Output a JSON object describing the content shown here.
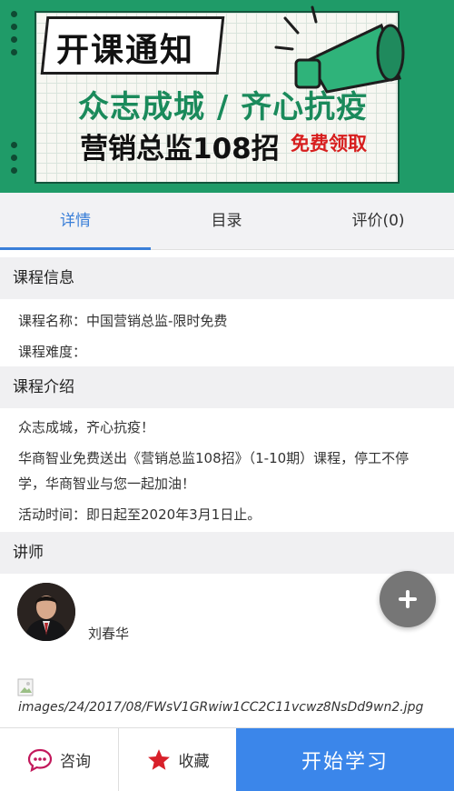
{
  "banner": {
    "title_tag": "开课通知",
    "line1": "众志成城 / 齐心抗疫",
    "line2": "营销总监108招",
    "free": "免费领取"
  },
  "tabs": [
    {
      "label": "详情",
      "active": true
    },
    {
      "label": "目录",
      "active": false
    },
    {
      "label": "评价(0)",
      "active": false
    }
  ],
  "course_info": {
    "heading": "课程信息",
    "name_line": "课程名称：中国营销总监-限时免费",
    "difficulty_line": "课程难度："
  },
  "course_intro": {
    "heading": "课程介绍",
    "p1": "众志成城，齐心抗疫！",
    "p2": "华商智业免费送出《营销总监108招》（1-10期）课程，停工不停学，华商智业与您一起加油！",
    "p3": "活动时间：即日起至2020年3月1日止。"
  },
  "lecturer": {
    "heading": "讲师",
    "name": "刘春华",
    "image_path": "images/24/2017/08/FWsV1GRwiw1CC2C11vcwz8NsDd9wn2.jpg"
  },
  "bottom_bar": {
    "consult": "咨询",
    "favorite": "收藏",
    "start": "开始学习"
  },
  "colors": {
    "accent": "#3a7fd8",
    "start_button": "#3b86ea",
    "banner_green": "#1f9b68",
    "star_red": "#d8202a",
    "chat_pink": "#c2185b"
  }
}
